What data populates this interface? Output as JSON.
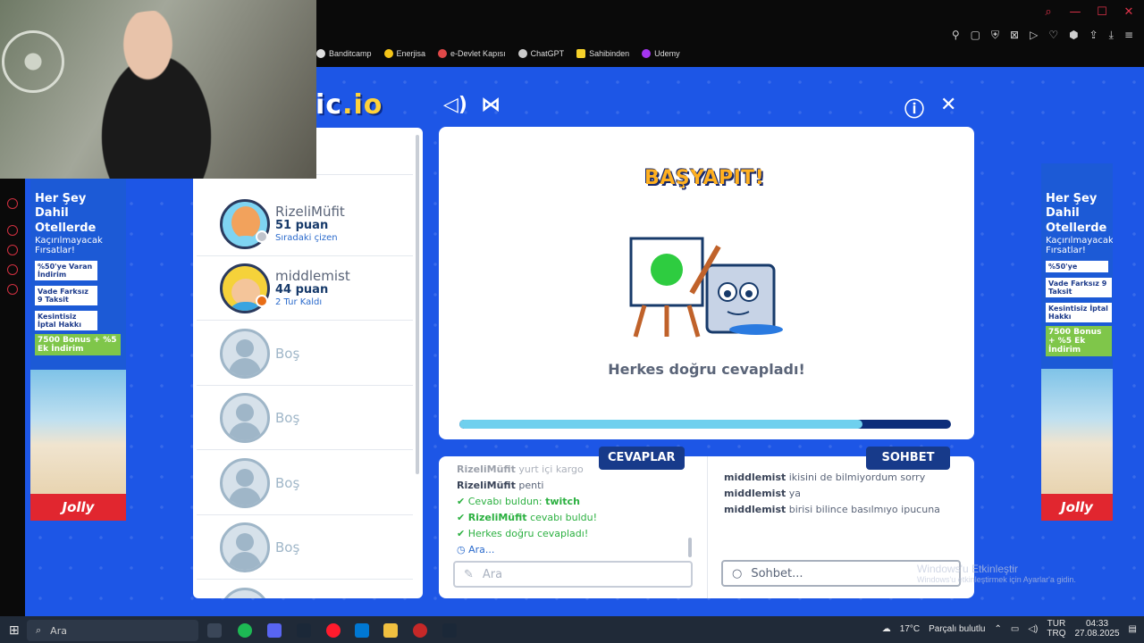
{
  "browser": {
    "bookmarks": [
      {
        "label": "Banditcamp",
        "color": "#e0e0e0"
      },
      {
        "label": "Enerjisa",
        "color": "#f5c518"
      },
      {
        "label": "e-Devlet Kapısı",
        "color": "#e04848"
      },
      {
        "label": "ChatGPT",
        "color": "#cccccc"
      },
      {
        "label": "Sahibinden",
        "color": "#f5d12a"
      },
      {
        "label": "Udemy",
        "color": "#a435f0"
      }
    ]
  },
  "game": {
    "logo_text": "ic",
    "logo_suffix": ".io",
    "players": [
      {
        "name": "RizeliMüfit",
        "points": "51 puan",
        "note": "Sıradaki çizen"
      },
      {
        "name": "middlemist",
        "points": "44 puan",
        "note": "2 Tur Kaldı"
      }
    ],
    "empty_slot_label": "Boş",
    "banner": "BAŞYAPIT!",
    "result_message": "Herkes doğru cevapladı!",
    "progress_fraction": 0.82,
    "answers": {
      "tab_label": "CEVAPLAR",
      "lines": [
        {
          "user": "RizeliMüfit",
          "text": "yurt içi kargo"
        },
        {
          "user": "RizeliMüfit",
          "text": "penti"
        }
      ],
      "found_prefix": "Cevabı buldun:",
      "found_word": "twitch",
      "found_user": "RizeliMüfit",
      "found_user_suffix": "cevabı buldu!",
      "all_correct": "Herkes doğru cevapladı!",
      "searching": "Ara...",
      "input_placeholder": "Ara"
    },
    "chat": {
      "tab_label": "SOHBET",
      "lines": [
        {
          "user": "middlemist",
          "text": "ikisini de bilmiyordum sorry"
        },
        {
          "user": "middlemist",
          "text": "ya"
        },
        {
          "user": "middlemist",
          "text": "birisi bilince basılmıyo ipucuna"
        }
      ],
      "input_placeholder": "Sohbet..."
    }
  },
  "ads": {
    "headline_1": "Her Şey Dahil",
    "headline_2": "Otellerde",
    "headline_3": "Kaçırılmayacak",
    "headline_4": "Fırsatlar!",
    "discount": "%50'ye",
    "discount_2": "Varan İndirim",
    "installment": "Vade Farksız 9 Taksit",
    "cancel": "Kesintisiz İptal Hakkı",
    "bonus": "7500 Bonus + %5 Ek İndirim",
    "brand": "Jolly"
  },
  "watermark": {
    "title": "Windows'u Etkinleştir",
    "subtitle": "Windows'u etkinleştirmek için Ayarlar'a gidin."
  },
  "taskbar": {
    "search_placeholder": "Ara",
    "weather": "17°C",
    "weather_text": "Parçalı bulutlu",
    "lang_1": "TUR",
    "lang_2": "TRQ",
    "time": "04:33",
    "date": "27.08.2025"
  }
}
